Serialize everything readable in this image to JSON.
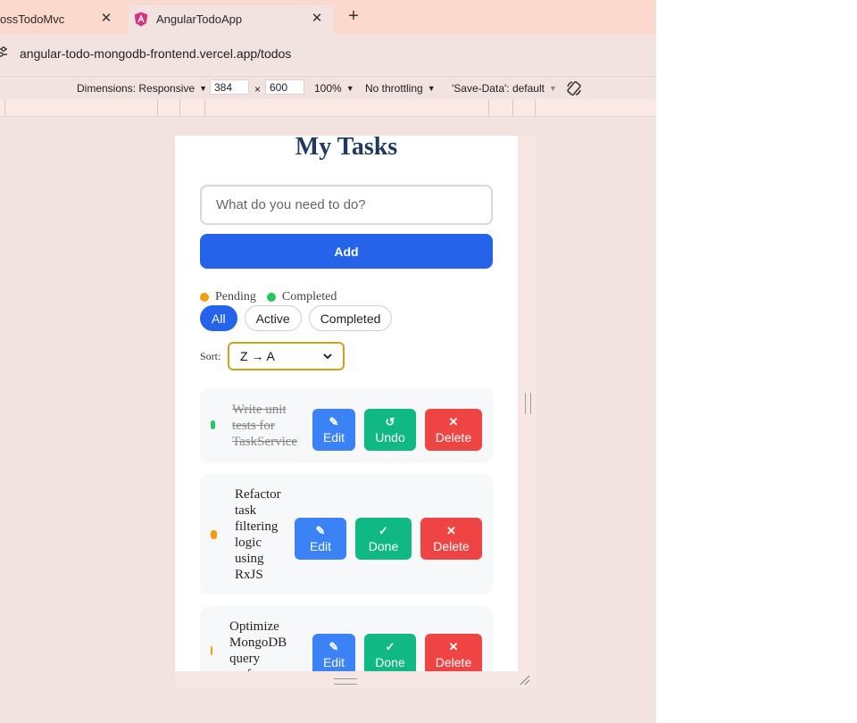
{
  "browser": {
    "tabs": [
      {
        "title": "ossTodoMvc",
        "active": false
      },
      {
        "title": "AngularTodoApp",
        "active": true
      }
    ],
    "url": "angular-todo-mongodb-frontend.vercel.app/todos"
  },
  "devtools": {
    "dimensions_label": "Dimensions: Responsive",
    "width": "384",
    "height": "600",
    "times": "×",
    "zoom": "100%",
    "throttling": "No throttling",
    "save_data": "'Save-Data': default"
  },
  "app": {
    "title": "My Tasks",
    "input_placeholder": "What do you need to do?",
    "add_label": "Add",
    "legend": {
      "pending": "Pending",
      "completed": "Completed",
      "pending_color": "#f59e0b",
      "completed_color": "#22c55e"
    },
    "filters": [
      "All",
      "Active",
      "Completed"
    ],
    "active_filter": "All",
    "sort_label": "Sort:",
    "sort_value": "Z → A",
    "tasks": [
      {
        "lines": [
          "Write unit",
          "tests for",
          "TaskService"
        ],
        "completed": true,
        "toggle_icon": "↺",
        "toggle_label": "Undo"
      },
      {
        "lines": [
          "Refactor",
          "task",
          "filtering",
          "logic",
          "using",
          "RxJS"
        ],
        "completed": false,
        "toggle_icon": "✓",
        "toggle_label": "Done"
      },
      {
        "lines": [
          "Optimize",
          "MongoDB",
          "query",
          "performance"
        ],
        "completed": false,
        "toggle_icon": "✓",
        "toggle_label": "Done"
      }
    ],
    "edit_icon": "✎",
    "edit_label": "Edit",
    "delete_icon": "✕",
    "delete_label": "Delete"
  }
}
